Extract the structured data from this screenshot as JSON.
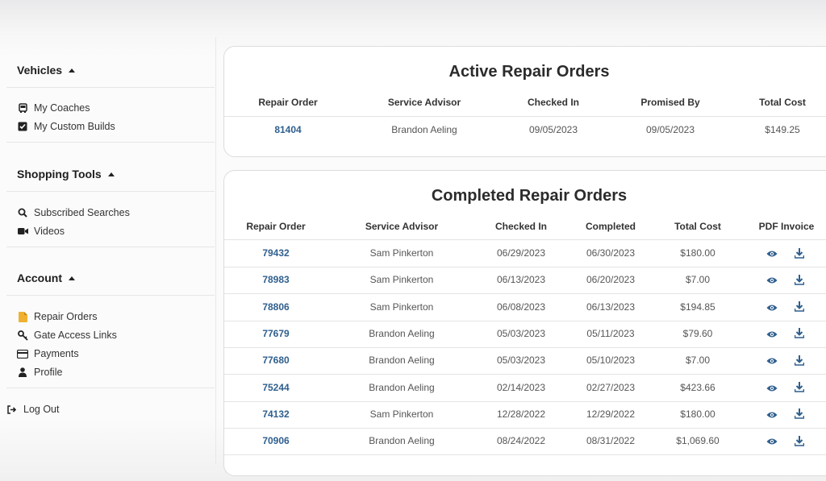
{
  "sidebar": {
    "sections": [
      {
        "title": "Vehicles",
        "items": [
          {
            "label": "My Coaches",
            "icon": "bus-icon"
          },
          {
            "label": "My Custom Builds",
            "icon": "checkbox-icon"
          }
        ]
      },
      {
        "title": "Shopping Tools",
        "items": [
          {
            "label": "Subscribed Searches",
            "icon": "search-icon"
          },
          {
            "label": "Videos",
            "icon": "video-camera-icon"
          }
        ]
      },
      {
        "title": "Account",
        "items": [
          {
            "label": "Repair Orders",
            "icon": "document-icon"
          },
          {
            "label": "Gate Access Links",
            "icon": "key-icon"
          },
          {
            "label": "Payments",
            "icon": "credit-card-icon"
          },
          {
            "label": "Profile",
            "icon": "user-icon"
          }
        ]
      }
    ],
    "logout": "Log Out"
  },
  "active": {
    "title": "Active Repair Orders",
    "columns": [
      "Repair Order",
      "Service Advisor",
      "Checked In",
      "Promised By",
      "Total Cost"
    ],
    "rows": [
      [
        "81404",
        "Brandon Aeling",
        "09/05/2023",
        "09/05/2023",
        "$149.25"
      ]
    ]
  },
  "completed": {
    "title": "Completed Repair Orders",
    "columns": [
      "Repair Order",
      "Service Advisor",
      "Checked In",
      "Completed",
      "Total Cost",
      "PDF Invoice"
    ],
    "rows": [
      [
        "79432",
        "Sam Pinkerton",
        "06/29/2023",
        "06/30/2023",
        "$180.00"
      ],
      [
        "78983",
        "Sam Pinkerton",
        "06/13/2023",
        "06/20/2023",
        "$7.00"
      ],
      [
        "78806",
        "Sam Pinkerton",
        "06/08/2023",
        "06/13/2023",
        "$194.85"
      ],
      [
        "77679",
        "Brandon Aeling",
        "05/03/2023",
        "05/11/2023",
        "$79.60"
      ],
      [
        "77680",
        "Brandon Aeling",
        "05/03/2023",
        "05/10/2023",
        "$7.00"
      ],
      [
        "75244",
        "Brandon Aeling",
        "02/14/2023",
        "02/27/2023",
        "$423.66"
      ],
      [
        "74132",
        "Sam Pinkerton",
        "12/28/2022",
        "12/29/2022",
        "$180.00"
      ],
      [
        "70906",
        "Brandon Aeling",
        "08/24/2022",
        "08/31/2022",
        "$1,069.60"
      ]
    ]
  },
  "colors": {
    "link": "#2f5f8e",
    "icon": "#2f5f8e",
    "document_icon": "#f0b030"
  }
}
